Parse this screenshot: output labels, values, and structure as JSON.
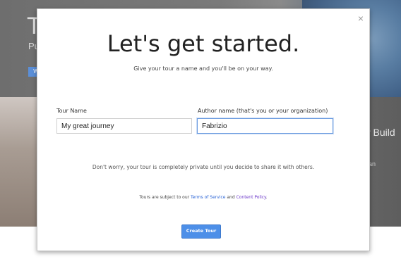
{
  "background": {
    "title_fragment": "T",
    "subtitle_fragment": "Pu",
    "button_fragment": "W",
    "right_text_fragment": "r Build",
    "right_subtext_fragment": "an"
  },
  "modal": {
    "close_glyph": "×",
    "heading": "Let's get started.",
    "subheading": "Give your tour a name and you'll be on your way.",
    "tour_name_label": "Tour Name",
    "tour_name_value": "My great journey",
    "author_label": "Author name (that's you or your organization)",
    "author_value": "Fabrizio",
    "privacy_notice": "Don't worry, your tour is completely private until you decide to share it with others.",
    "terms_prefix": "Tours are subject to our ",
    "terms_link": "Terms of Service",
    "terms_and": " and ",
    "policy_link": "Content Policy",
    "terms_suffix": ".",
    "create_button": "Create Tour"
  },
  "colors": {
    "primary_button": "#4d8fe8",
    "link_blue": "#2b64d6",
    "link_purple": "#6a36c9",
    "focus_border": "#6b9be0"
  }
}
